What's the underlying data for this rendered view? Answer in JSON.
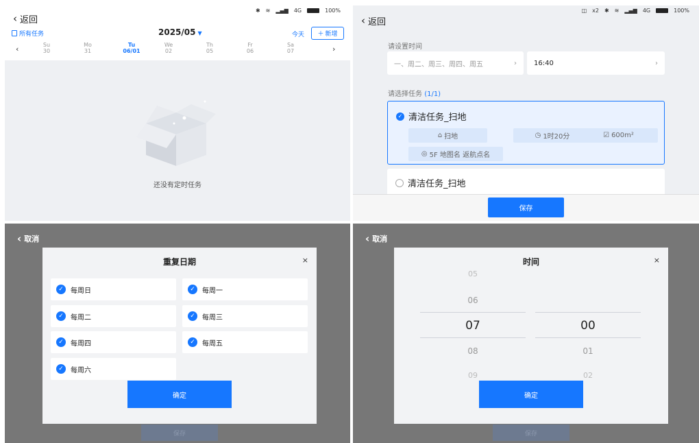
{
  "status": {
    "network": "4G",
    "battery": "100%",
    "robots": "x2"
  },
  "back_label": "返回",
  "calendar": {
    "all_tasks": "所有任务",
    "month": "2025/05",
    "today": "今天",
    "new": "新增",
    "days": [
      {
        "name": "Su",
        "date": "30"
      },
      {
        "name": "Mo",
        "date": "31"
      },
      {
        "name": "Tu",
        "date": "06/01"
      },
      {
        "name": "We",
        "date": "02"
      },
      {
        "name": "Th",
        "date": "05"
      },
      {
        "name": "Fr",
        "date": "06"
      },
      {
        "name": "Sa",
        "date": "07"
      }
    ],
    "empty_text": "还没有定时任务"
  },
  "setup": {
    "time_label": "请设置时间",
    "repeat_days": "一、周二、周三、周四、周五",
    "time": "16:40",
    "task_label": "请选择任务",
    "task_count": "(1/1)",
    "task1": {
      "title": "清洁任务_扫地",
      "mode": "扫地",
      "duration": "1时20分",
      "area": "600m²",
      "location": "5F 地图名 返航点名"
    },
    "task2": {
      "title": "清洁任务_扫地"
    },
    "save": "保存"
  },
  "cancel_label": "取消",
  "repeat_dialog": {
    "title": "重复日期",
    "options": [
      "每周日",
      "每周一",
      "每周二",
      "每周三",
      "每周四",
      "每周五",
      "每周六"
    ],
    "confirm": "确定"
  },
  "time_dialog": {
    "title": "时间",
    "hours": [
      "05",
      "06",
      "07",
      "08",
      "09"
    ],
    "minutes": [
      "00",
      "01",
      "02"
    ],
    "confirm": "确定"
  },
  "bg_save": "保存"
}
